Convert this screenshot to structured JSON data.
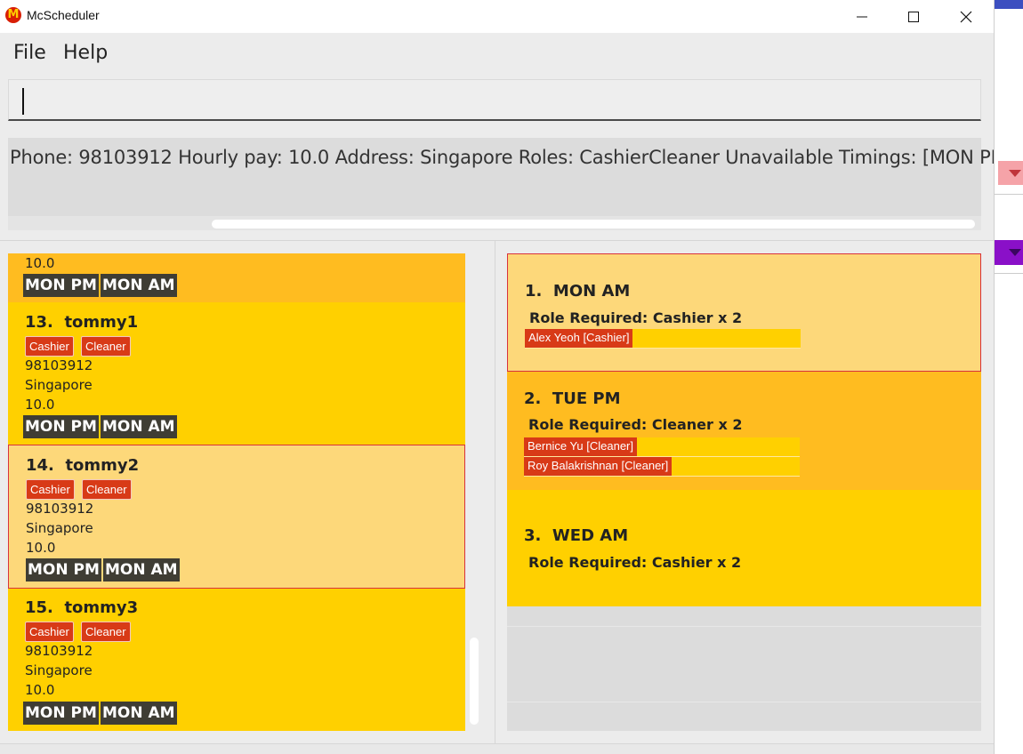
{
  "window": {
    "title": "McScheduler",
    "icon": "mcdonalds-logo-icon",
    "controls": [
      "minimize-icon",
      "maximize-icon",
      "close-icon"
    ]
  },
  "menu": {
    "file": "File",
    "help": "Help"
  },
  "command_box": {
    "value": ""
  },
  "result_display": {
    "text": "Phone: 98103912 Hourly pay: 10.0 Address: Singapore Roles: CashierCleaner Unavailable Timings: [MON PM][MON AM]"
  },
  "workers": {
    "partial_top": {
      "pay": "10.0",
      "timings": [
        "MON PM",
        "MON AM"
      ]
    },
    "items": [
      {
        "index": "13.",
        "name": "tommy1",
        "roles": [
          "Cashier",
          "Cleaner"
        ],
        "phone": "98103912",
        "address": "Singapore",
        "pay": "10.0",
        "timings": [
          "MON PM",
          "MON AM"
        ],
        "selected": false
      },
      {
        "index": "14.",
        "name": "tommy2",
        "roles": [
          "Cashier",
          "Cleaner"
        ],
        "phone": "98103912",
        "address": "Singapore",
        "pay": "10.0",
        "timings": [
          "MON PM",
          "MON AM"
        ],
        "selected": true
      },
      {
        "index": "15.",
        "name": "tommy3",
        "roles": [
          "Cashier",
          "Cleaner"
        ],
        "phone": "98103912",
        "address": "Singapore",
        "pay": "10.0",
        "timings": [
          "MON PM",
          "MON AM"
        ],
        "selected": false
      }
    ]
  },
  "shifts": {
    "items": [
      {
        "index": "1.",
        "name": "MON AM",
        "role": "Role Required: Cashier x 2",
        "assigned": [
          "Alex Yeoh [Cashier]"
        ],
        "selected": true
      },
      {
        "index": "2.",
        "name": "TUE PM",
        "role": "Role Required: Cleaner x 2",
        "assigned": [
          "Bernice Yu [Cleaner]",
          "Roy Balakrishnan [Cleaner]"
        ],
        "selected": false
      },
      {
        "index": "3.",
        "name": "WED AM",
        "role": "Role Required: Cashier x 2",
        "assigned": [],
        "selected": false
      }
    ]
  },
  "colors": {
    "card_yellow": "#ffd000",
    "card_orange": "#ffbc20",
    "selected": "#fdd87a",
    "selected_border": "#d8323c",
    "role_tag": "#d83a17",
    "timing_tag": "#3f3d34"
  }
}
